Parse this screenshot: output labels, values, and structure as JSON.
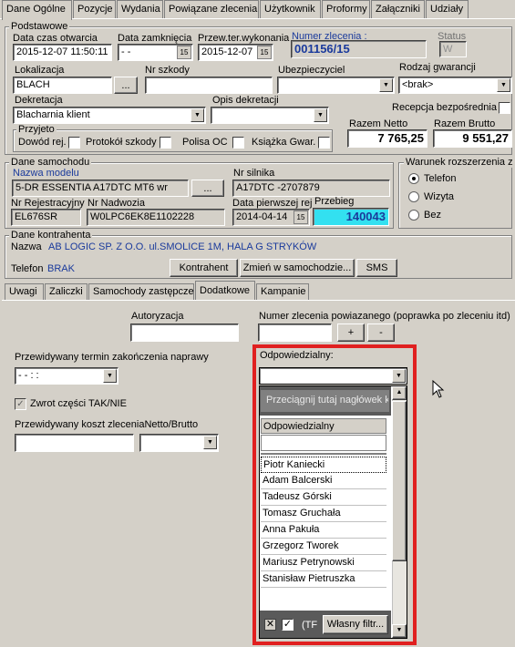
{
  "top_tabs": [
    "Dane Ogólne",
    "Pozycje",
    "Wydania",
    "Powiązane zlecenia",
    "Użytkownik",
    "Proformy",
    "Załączniki",
    "Udziały"
  ],
  "podstawowe": {
    "group_label": "Podstawowe",
    "data_otwarcia_label": "Data czas otwarcia",
    "data_otwarcia": "2015-12-07 11:50:11",
    "data_zamkniecia_label": "Data zamknięcia",
    "data_zamkniecia": " -  - ",
    "przew_ter_label": "Przew.ter.wykonania",
    "przew_ter": "2015-12-07",
    "numer_label": "Numer zlecenia :",
    "numer": "001156/15",
    "status_label": "Status",
    "status": "W",
    "lokalizacja_label": "Lokalizacja",
    "lokalizacja": "BLACH",
    "nr_szkody_label": "Nr szkody",
    "nr_szkody": "",
    "ubezpieczyciel_label": "Ubezpieczyciel",
    "ubezpieczyciel": "",
    "rodzaj_gwarancji_label": "Rodzaj gwarancji",
    "rodzaj_gwarancji": "<brak>",
    "dekretacja_label": "Dekretacja",
    "dekretacja": "Blacharnia klient",
    "opis_dekretacji_label": "Opis dekretacji",
    "opis_dekretacji": "",
    "recepcja_label": "Recepcja bezpośrednia",
    "razem_netto_label": "Razem Netto",
    "razem_netto": "7 765,25",
    "razem_brutto_label": "Razem Brutto",
    "razem_brutto": "9 551,27",
    "przyjeto_label": "Przyjeto",
    "dowod": "Dowód rej.",
    "protokol": "Protokół szkody",
    "polisa": "Polisa OC",
    "ksiazka": "Książka Gwar.",
    "dots": "..."
  },
  "samochod": {
    "group_label": "Dane samochodu",
    "nazwa_modelu_label": "Nazwa modelu",
    "nazwa_modelu": "5-DR ESSENTIA A17DTC MT6 wr",
    "nr_silnika_label": "Nr silnika",
    "nr_silnika": "A17DTC -2707879",
    "nr_rej_label": "Nr Rejestracyjny",
    "nr_rej": "EL676SR",
    "nr_nadwozia_label": "Nr Nadwozia",
    "nr_nadwozia": "W0LPC6EK8E1102228",
    "data_pierwszej_label": "Data pierwszej rej",
    "data_pierwszej": "2014-04-14",
    "przebieg_label": "Przebieg",
    "przebieg": "140043",
    "dots": "..."
  },
  "warunek": {
    "group_label": "Warunek rozszerzenia z",
    "options": [
      "Telefon",
      "Wizyta",
      "Bez"
    ]
  },
  "kontrahent": {
    "group_label": "Dane kontrahenta",
    "nazwa_label": "Nazwa",
    "nazwa": "AB LOGIC SP. Z O.O.  ul.SMOLICE 1M, HALA G  STRYKÓW",
    "telefon_label": "Telefon",
    "telefon": "BRAK",
    "btn_kontrahent": "Kontrahent",
    "btn_zmien": "Zmień w samochodzie...",
    "btn_sms": "SMS"
  },
  "sub_tabs": [
    "Uwagi",
    "Zaliczki",
    "Samochody zastępcze",
    "Dodatkowe",
    "Kampanie"
  ],
  "dodatkowe": {
    "autoryzacja_label": "Autoryzacja",
    "numer_powiazanego_label": "Numer zlecenia powiazanego (poprawka po zleceniu itd)",
    "plus": "+",
    "minus": "-",
    "termin_label": "Przewidywany termin zakończenia naprawy",
    "termin_value": " -  -      :  :",
    "zwrot_label": "Zwrot części TAK/NIE",
    "koszt_label": "Przewidywany koszt zleceniaNetto/Brutto",
    "odpowiedzialny_label": "Odpowiedzialny:",
    "drag_hint": "Przeciągnij tutaj nagłówek k",
    "column_header": "Odpowiedzialny",
    "people": [
      "Piotr Kaniecki",
      "Adam Balcerski",
      "Tadeusz Górski",
      "Tomasz Gruchała",
      "Anna Pakuła",
      "Grzegorz Tworek",
      "Mariusz Petrynowski",
      "Stanisław Pietruszka"
    ],
    "filter_text": "(TF",
    "filter_button": "Własny filtr..."
  },
  "colors": {
    "highlight_red": "#e02020",
    "przebieg_bg": "#33e0f0",
    "blue_text": "#1a3a9c",
    "dark_panel": "#5a5a5a"
  }
}
